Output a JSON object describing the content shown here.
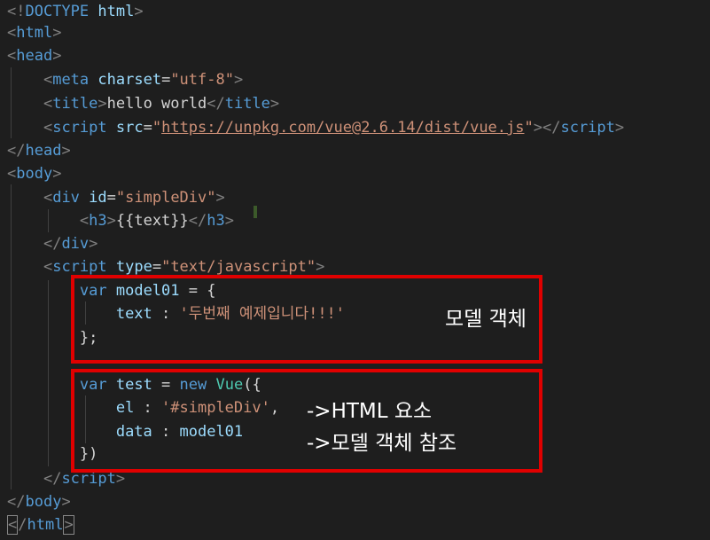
{
  "code": {
    "doctype_open": "<!",
    "doctype_kw": "DOCTYPE",
    "doctype_val": " html",
    "doctype_close": ">",
    "html_tag": "html",
    "head_tag": "head",
    "meta_tag": "meta",
    "charset_attr": "charset",
    "charset_val": "\"utf-8\"",
    "title_tag": "title",
    "title_text": "hello world",
    "script_tag": "script",
    "src_attr": "src",
    "src_val": "https://unpkg.com/vue@2.6.14/dist/vue.js",
    "body_tag": "body",
    "div_tag": "div",
    "id_attr": "id",
    "id_val": "\"simpleDiv\"",
    "h3_tag": "h3",
    "h3_text": "{{text}}",
    "type_attr": "type",
    "type_val": "\"text/javascript\"",
    "kw_var": "var",
    "model_name": "model01",
    "model_open": " = {",
    "text_key": "text",
    "colon_sep": " : ",
    "text_val": "'두번째 예제입니다!!!'",
    "model_close": "};",
    "test_name": "test",
    "kw_new": "new",
    "vue_cls": "Vue",
    "vue_open": "({",
    "el_key": "el",
    "el_val": "'#simpleDiv'",
    "comma": ",",
    "data_key": "data",
    "data_val": "model01",
    "vue_close": "})"
  },
  "annotations": {
    "model_object": "모델 객체",
    "html_element": "->HTML 요소",
    "model_ref": "->모델 객체 참조"
  },
  "colors": {
    "highlight": "#e00000",
    "background": "#1e1e1e"
  }
}
